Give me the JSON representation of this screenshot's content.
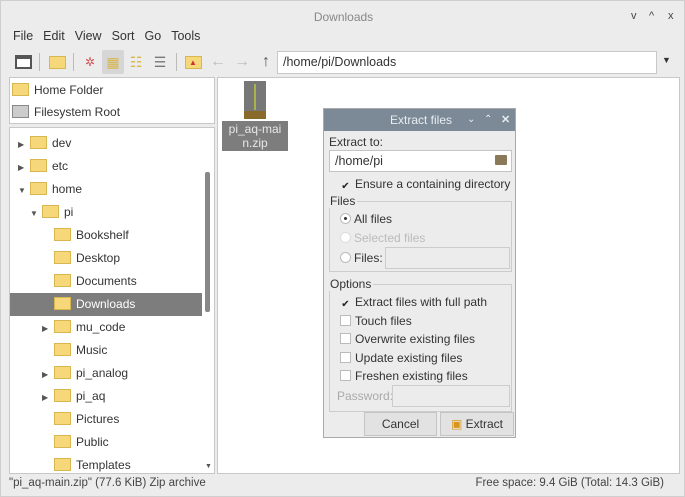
{
  "window": {
    "title": "Downloads",
    "controls": [
      "v",
      "^",
      "x"
    ]
  },
  "menu": [
    "File",
    "Edit",
    "View",
    "Sort",
    "Go",
    "Tools"
  ],
  "toolbar": {
    "path": "/home/pi/Downloads"
  },
  "places": [
    "Home Folder",
    "Filesystem Root"
  ],
  "tree": [
    {
      "label": "dev",
      "level": 0,
      "arrow": "▶",
      "icon": "folder"
    },
    {
      "label": "etc",
      "level": 0,
      "arrow": "▶",
      "icon": "folder"
    },
    {
      "label": "home",
      "level": 0,
      "arrow": "▼",
      "icon": "folder"
    },
    {
      "label": "pi",
      "level": 1,
      "arrow": "▼",
      "icon": "home"
    },
    {
      "label": "Bookshelf",
      "level": 2,
      "arrow": "",
      "icon": "folder"
    },
    {
      "label": "Desktop",
      "level": 2,
      "arrow": "",
      "icon": "folder"
    },
    {
      "label": "Documents",
      "level": 2,
      "arrow": "",
      "icon": "folder"
    },
    {
      "label": "Downloads",
      "level": 2,
      "arrow": "",
      "icon": "folder",
      "selected": true
    },
    {
      "label": "mu_code",
      "level": 2,
      "arrow": "▶",
      "icon": "folder"
    },
    {
      "label": "Music",
      "level": 2,
      "arrow": "",
      "icon": "folder"
    },
    {
      "label": "pi_analog",
      "level": 2,
      "arrow": "▶",
      "icon": "folder"
    },
    {
      "label": "pi_aq",
      "level": 2,
      "arrow": "▶",
      "icon": "folder"
    },
    {
      "label": "Pictures",
      "level": 2,
      "arrow": "",
      "icon": "folder"
    },
    {
      "label": "Public",
      "level": 2,
      "arrow": "",
      "icon": "folder"
    },
    {
      "label": "Templates",
      "level": 2,
      "arrow": "",
      "icon": "folder"
    }
  ],
  "files": [
    {
      "name": "pi_aq-main.zip"
    }
  ],
  "status": {
    "left": "\"pi_aq-main.zip\" (77.6 KiB) Zip archive",
    "right": "Free space: 9.4 GiB (Total: 14.3 GiB)"
  },
  "dialog": {
    "title": "Extract files",
    "extract_to_label": "Extract to:",
    "extract_to_value": "/home/pi",
    "ensure_dir": "Ensure a containing directory",
    "files_group": "Files",
    "all_files": "All files",
    "selected_files": "Selected files",
    "files_label": "Files:",
    "options_group": "Options",
    "options": [
      {
        "label": "Extract files with full path",
        "checked": true
      },
      {
        "label": "Touch files",
        "checked": false
      },
      {
        "label": "Overwrite existing files",
        "checked": false
      },
      {
        "label": "Update existing files",
        "checked": false
      },
      {
        "label": "Freshen existing files",
        "checked": false
      }
    ],
    "password_label": "Password:",
    "cancel": "Cancel",
    "extract": "Extract"
  }
}
